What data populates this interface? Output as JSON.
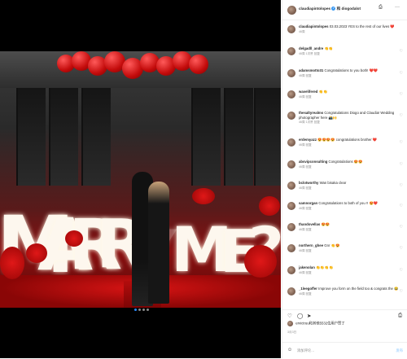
{
  "post": {
    "author": "claudiapintolopes",
    "with_word": "和",
    "coauthor": "diogodalot",
    "menu_icon": "more-icon",
    "save_icon": "bookmark-icon"
  },
  "photo": {
    "letters": [
      "M",
      "A",
      "R",
      "R",
      "Y",
      "M",
      "E",
      "?"
    ],
    "carousel": {
      "count": 4,
      "active": 1
    }
  },
  "caption": {
    "user": "claudiapintolopes",
    "text": "03.03.2023 YES to the rest of our lives ❤️",
    "time": "46周"
  },
  "comments": [
    {
      "user": "delgadll_andre",
      "text": "👏👏",
      "time": "46周",
      "extra": "1次赞",
      "reply": "回复"
    },
    {
      "user": "adamsmotto31",
      "text": "Congratulations to you both! ❤️❤️",
      "time": "46周",
      "extra": "",
      "reply": "回复"
    },
    {
      "user": "wavelifered",
      "text": "👏👏",
      "time": "46周",
      "extra": "",
      "reply": "回复"
    },
    {
      "user": "thesaltyrealms",
      "text": "Congratulations Diogo and Claudia! Wedding photographer here 📸🙌",
      "time": "46周",
      "extra": "1次赞",
      "reply": "回复"
    },
    {
      "user": "erdemyazz",
      "text": "😍😍😍😍 congratulations brother ❤️",
      "time": "46周",
      "extra": "",
      "reply": "回复"
    },
    {
      "user": "absvipconsulting",
      "text": "Congratulations 😍😍",
      "time": "46周",
      "extra": "",
      "reply": "回复"
    },
    {
      "user": "bclotworthy",
      "text": "Wan bisaka clear",
      "time": "46周",
      "extra": "",
      "reply": "回复"
    },
    {
      "user": "samnorgan",
      "text": "Congratulations to both of you !! 😍❤️",
      "time": "46周",
      "extra": "",
      "reply": "回复"
    },
    {
      "user": "thandovellas",
      "text": "😍😍",
      "time": "46周",
      "extra": "",
      "reply": "回复"
    },
    {
      "user": "northern_ghee",
      "text": "Gnr 👏😍",
      "time": "46周",
      "extra": "",
      "reply": "回复"
    },
    {
      "user": "jakenolan",
      "text": "👏👏👏👏",
      "time": "46周",
      "extra": "",
      "reply": "回复"
    },
    {
      "user": "_1leegoffer",
      "text": "Improve you form on the field too & congrats the 😂",
      "time": "46周",
      "extra": "",
      "reply": "回复"
    }
  ],
  "actions": {
    "like_icon": "heart-icon",
    "comment_icon": "comment-icon",
    "share_icon": "send-icon",
    "save_icon": "bookmark-icon"
  },
  "likes": {
    "text": "ervictruu和其他5532位用户赞了"
  },
  "date": "3月3日",
  "add_comment": {
    "placeholder": "添加评论…",
    "post_label": "发布",
    "emoji_icon": "smiley-icon"
  }
}
